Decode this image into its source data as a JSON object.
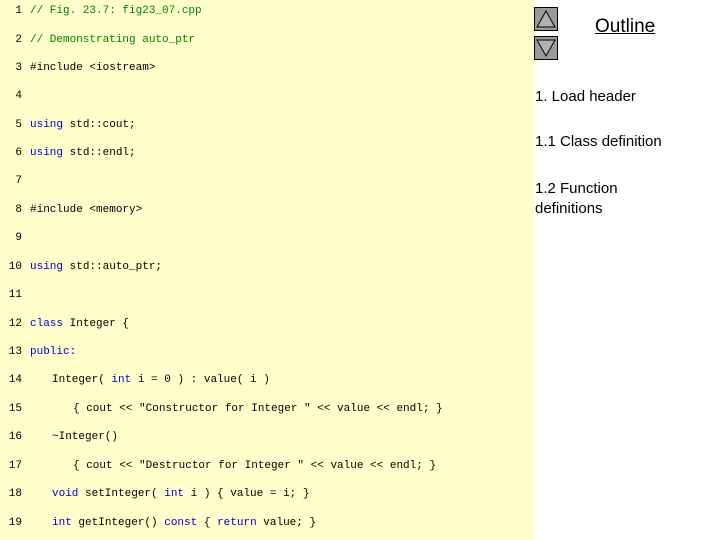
{
  "outline": {
    "title": "Outline",
    "up_icon": "triangle-up-icon",
    "down_icon": "triangle-down-icon",
    "items": [
      {
        "label": "1. Load header"
      },
      {
        "label": "1.1 Class definition"
      },
      {
        "label": "1.2 Function definitions"
      }
    ]
  },
  "code_lines": [
    {
      "num": "1",
      "indent": 0,
      "parts": [
        {
          "t": "// Fig. 23.7: fig23_07.cpp",
          "c": "cm"
        }
      ]
    },
    {
      "num": "2",
      "indent": 0,
      "parts": [
        {
          "t": "// Demonstrating auto_ptr",
          "c": "cm"
        }
      ]
    },
    {
      "num": "3",
      "indent": 0,
      "parts": [
        {
          "t": "#include <iostream>",
          "c": ""
        }
      ]
    },
    {
      "num": "4",
      "indent": 0,
      "parts": []
    },
    {
      "num": "5",
      "indent": 0,
      "parts": [
        {
          "t": "using",
          "c": "kw"
        },
        {
          "t": " std::cout;",
          "c": ""
        }
      ]
    },
    {
      "num": "6",
      "indent": 0,
      "parts": [
        {
          "t": "using",
          "c": "kw"
        },
        {
          "t": " std::endl;",
          "c": ""
        }
      ]
    },
    {
      "num": "7",
      "indent": 0,
      "parts": []
    },
    {
      "num": "8",
      "indent": 0,
      "parts": [
        {
          "t": "#include <memory>",
          "c": ""
        }
      ]
    },
    {
      "num": "9",
      "indent": 0,
      "parts": []
    },
    {
      "num": "10",
      "indent": 0,
      "parts": [
        {
          "t": "using",
          "c": "kw"
        },
        {
          "t": " std::auto_ptr;",
          "c": ""
        }
      ]
    },
    {
      "num": "11",
      "indent": 0,
      "parts": []
    },
    {
      "num": "12",
      "indent": 0,
      "parts": [
        {
          "t": "class",
          "c": "kw"
        },
        {
          "t": " Integer {",
          "c": ""
        }
      ]
    },
    {
      "num": "13",
      "indent": 0,
      "parts": [
        {
          "t": "public:",
          "c": "kw"
        }
      ]
    },
    {
      "num": "14",
      "indent": 1,
      "parts": [
        {
          "t": "Integer( ",
          "c": ""
        },
        {
          "t": "int",
          "c": "kw"
        },
        {
          "t": " i = 0 ) : value( i )",
          "c": ""
        }
      ]
    },
    {
      "num": "15",
      "indent": 2,
      "parts": [
        {
          "t": "{ cout << \"Constructor for Integer \" << value << endl; }",
          "c": ""
        }
      ]
    },
    {
      "num": "16",
      "indent": 1,
      "parts": [
        {
          "t": "~Integer()",
          "c": ""
        }
      ]
    },
    {
      "num": "17",
      "indent": 2,
      "parts": [
        {
          "t": "{ cout << \"Destructor for Integer \" << value << endl; }",
          "c": ""
        }
      ]
    },
    {
      "num": "18",
      "indent": 1,
      "parts": [
        {
          "t": "void",
          "c": "kw"
        },
        {
          "t": " setInteger( ",
          "c": ""
        },
        {
          "t": "int",
          "c": "kw"
        },
        {
          "t": " i ) { value = i; }",
          "c": ""
        }
      ]
    },
    {
      "num": "19",
      "indent": 1,
      "parts": [
        {
          "t": "int",
          "c": "kw"
        },
        {
          "t": " getInteger() ",
          "c": ""
        },
        {
          "t": "const",
          "c": "kw"
        },
        {
          "t": " { ",
          "c": ""
        },
        {
          "t": "return",
          "c": "kw"
        },
        {
          "t": " value; }",
          "c": ""
        }
      ]
    }
  ]
}
